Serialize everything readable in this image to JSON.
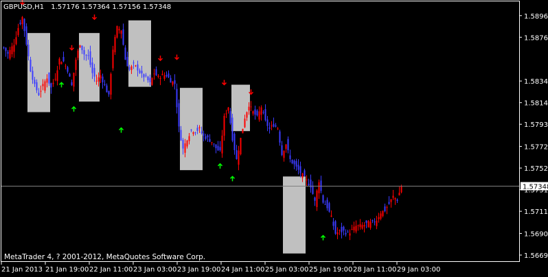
{
  "header": {
    "symbol_timeframe": "GBPUSD,H1",
    "ohlc": "1.57176 1.57364 1.57156 1.57348"
  },
  "footer": {
    "copyright": "MetaTrader 4, ? 2001-2012, MetaQuotes Software Corp."
  },
  "colors": {
    "background": "#000000",
    "axis": "#ffffff",
    "bull": "#ff0000",
    "bear": "#3b3bff",
    "box_fill": "#c0c0c0",
    "arrow_down": "#ff0000",
    "arrow_up": "#00ff00",
    "price_line": "#808080"
  },
  "chart_data": {
    "type": "candlestick",
    "title": "GBPUSD,H1",
    "ylim": [
      1.5663,
      1.591
    ],
    "x_tick_labels": [
      "21 Jan 2013",
      "21 Jan 19:00",
      "22 Jan 11:00",
      "23 Jan 03:00",
      "23 Jan 19:00",
      "24 Jan 11:00",
      "25 Jan 03:00",
      "25 Jan 19:00",
      "28 Jan 11:00",
      "29 Jan 03:00"
    ],
    "y_ticks": [
      {
        "value": 1.58965,
        "label": "1.58965"
      },
      {
        "value": 1.5876,
        "label": "1.58760"
      },
      {
        "value": 1.58345,
        "label": "1.58345"
      },
      {
        "value": 1.5814,
        "label": "1.58140"
      },
      {
        "value": 1.57935,
        "label": "1.57935"
      },
      {
        "value": 1.57725,
        "label": "1.57725"
      },
      {
        "value": 1.5752,
        "label": "1.57520"
      },
      {
        "value": 1.57315,
        "label": "1.57315"
      },
      {
        "value": 1.5711,
        "label": "1.57110"
      },
      {
        "value": 1.569,
        "label": "1.56900"
      },
      {
        "value": 1.56695,
        "label": "1.56695"
      }
    ],
    "current_price": {
      "value": 1.57348,
      "label": "1.57348"
    },
    "anchors": [
      [
        0,
        1.5866
      ],
      [
        2,
        1.586
      ],
      [
        5,
        1.587
      ],
      [
        7,
        1.5885
      ],
      [
        9,
        1.5895
      ],
      [
        11,
        1.587
      ],
      [
        13,
        1.5845
      ],
      [
        15,
        1.583
      ],
      [
        17,
        1.5822
      ],
      [
        19,
        1.583
      ],
      [
        21,
        1.5838
      ],
      [
        23,
        1.5828
      ],
      [
        25,
        1.5838
      ],
      [
        27,
        1.5855
      ],
      [
        29,
        1.5853
      ],
      [
        31,
        1.5845
      ],
      [
        33,
        1.583
      ],
      [
        35,
        1.5855
      ],
      [
        37,
        1.587
      ],
      [
        39,
        1.586
      ],
      [
        41,
        1.5858
      ],
      [
        43,
        1.5842
      ],
      [
        45,
        1.5835
      ],
      [
        47,
        1.584
      ],
      [
        49,
        1.583
      ],
      [
        51,
        1.582
      ],
      [
        53,
        1.5865
      ],
      [
        55,
        1.5885
      ],
      [
        57,
        1.5883
      ],
      [
        59,
        1.5855
      ],
      [
        61,
        1.5845
      ],
      [
        63,
        1.585
      ],
      [
        65,
        1.5846
      ],
      [
        67,
        1.584
      ],
      [
        69,
        1.5838
      ],
      [
        71,
        1.5832
      ],
      [
        73,
        1.5842
      ],
      [
        75,
        1.5838
      ],
      [
        77,
        1.584
      ],
      [
        79,
        1.584
      ],
      [
        81,
        1.5835
      ],
      [
        83,
        1.5832
      ],
      [
        85,
        1.579
      ],
      [
        87,
        1.577
      ],
      [
        89,
        1.578
      ],
      [
        91,
        1.5788
      ],
      [
        93,
        1.5787
      ],
      [
        95,
        1.5789
      ],
      [
        97,
        1.5782
      ],
      [
        99,
        1.578
      ],
      [
        101,
        1.5777
      ],
      [
        103,
        1.5771
      ],
      [
        105,
        1.5767
      ],
      [
        107,
        1.58
      ],
      [
        109,
        1.581
      ],
      [
        111,
        1.578
      ],
      [
        113,
        1.576
      ],
      [
        115,
        1.578
      ],
      [
        117,
        1.58
      ],
      [
        119,
        1.5812
      ],
      [
        121,
        1.5805
      ],
      [
        123,
        1.58
      ],
      [
        125,
        1.581
      ],
      [
        127,
        1.5796
      ],
      [
        129,
        1.5789
      ],
      [
        131,
        1.5793
      ],
      [
        133,
        1.579
      ],
      [
        135,
        1.5765
      ],
      [
        137,
        1.5775
      ],
      [
        139,
        1.576
      ],
      [
        141,
        1.5755
      ],
      [
        143,
        1.575
      ],
      [
        145,
        1.5745
      ],
      [
        147,
        1.574
      ],
      [
        149,
        1.5735
      ],
      [
        151,
        1.572
      ],
      [
        153,
        1.574
      ],
      [
        155,
        1.572
      ],
      [
        157,
        1.5715
      ],
      [
        159,
        1.5705
      ],
      [
        161,
        1.569
      ],
      [
        163,
        1.5692
      ],
      [
        165,
        1.5692
      ],
      [
        167,
        1.569
      ],
      [
        169,
        1.5693
      ],
      [
        171,
        1.5697
      ],
      [
        173,
        1.5697
      ],
      [
        175,
        1.5698
      ],
      [
        177,
        1.57
      ],
      [
        179,
        1.57
      ],
      [
        181,
        1.5703
      ],
      [
        183,
        1.571
      ],
      [
        185,
        1.5712
      ],
      [
        187,
        1.5718
      ],
      [
        189,
        1.5725
      ],
      [
        191,
        1.5722
      ],
      [
        193,
        1.5735
      ]
    ],
    "boxes": [
      {
        "from": 12,
        "to": 23,
        "high": 1.588,
        "low": 1.5805
      },
      {
        "from": 37,
        "to": 47,
        "high": 1.588,
        "low": 1.5815
      },
      {
        "from": 61,
        "to": 72,
        "high": 1.5892,
        "low": 1.5829
      },
      {
        "from": 86,
        "to": 97,
        "high": 1.5828,
        "low": 1.575
      },
      {
        "from": 111,
        "to": 120,
        "high": 1.5831,
        "low": 1.5787
      },
      {
        "from": 136,
        "to": 147,
        "high": 1.5744,
        "low": 1.5671
      }
    ],
    "arrows_down": [
      {
        "bar": 9,
        "price": 1.5907
      },
      {
        "bar": 33,
        "price": 1.5864
      },
      {
        "bar": 44,
        "price": 1.5893
      },
      {
        "bar": 76,
        "price": 1.5854
      },
      {
        "bar": 84,
        "price": 1.5855
      },
      {
        "bar": 107,
        "price": 1.5831
      },
      {
        "bar": 120,
        "price": 1.5822
      }
    ],
    "arrows_up": [
      {
        "bar": 28,
        "price": 1.5833
      },
      {
        "bar": 34,
        "price": 1.581
      },
      {
        "bar": 57,
        "price": 1.579
      },
      {
        "bar": 105,
        "price": 1.5756
      },
      {
        "bar": 111,
        "price": 1.5744
      },
      {
        "bar": 155,
        "price": 1.5688
      }
    ]
  }
}
